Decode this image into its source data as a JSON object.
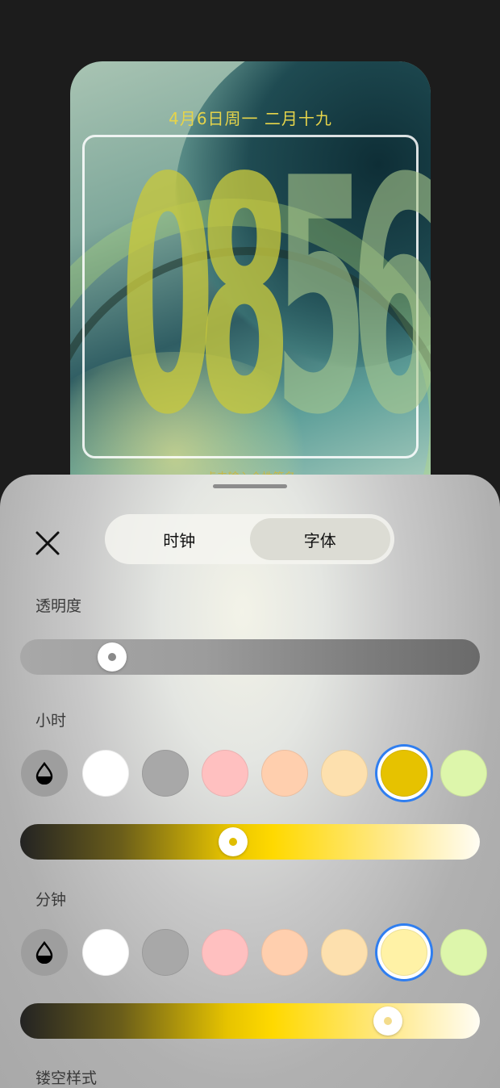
{
  "preview": {
    "date_text": "4月6日周一 二月十九",
    "hour_digits": [
      "0",
      "8"
    ],
    "minute_digits": [
      "5",
      "6"
    ],
    "hint_text": "点击输入个性签名"
  },
  "sheet": {
    "tabs": [
      {
        "label": "时钟",
        "selected": false
      },
      {
        "label": "字体",
        "selected": true
      }
    ],
    "opacity": {
      "label": "透明度",
      "value": 0.18
    },
    "hour": {
      "label": "小时",
      "swatches": [
        "#ffffff",
        "#a8a8a8",
        "#ffc0c0",
        "#ffcfae",
        "#fde0ae",
        "#e6c200",
        "#ddf6ab"
      ],
      "selected_swatch": "#e6c200",
      "slider_value": 0.46
    },
    "minute": {
      "label": "分钟",
      "swatches": [
        "#ffffff",
        "#a8a8a8",
        "#ffc0c0",
        "#ffcfae",
        "#fde0ae",
        "#fff2a6",
        "#ddf6ab"
      ],
      "selected_swatch": "#fff2a6",
      "slider_value": 0.82
    },
    "hollow_style_label": "镂空样式"
  },
  "icons": {
    "close": "close-icon",
    "eyedropper": "droplet-icon"
  },
  "colors": {
    "accent": "#2f7ef0",
    "date_text": "#e6d44a",
    "hour_color": "#e6c200"
  }
}
